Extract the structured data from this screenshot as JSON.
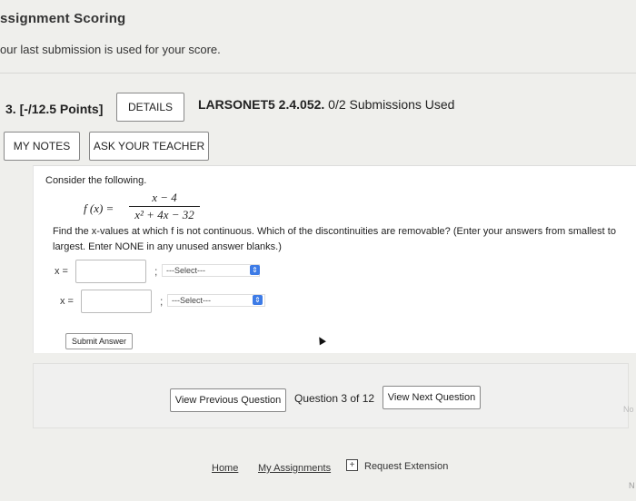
{
  "header": {
    "title": "ssignment Scoring",
    "subtitle": "our last submission is used for your score."
  },
  "question": {
    "number": "3. [-/12.5 Points]",
    "details_label": "DETAILS",
    "source": "LARSONET5 2.4.052.",
    "submissions": "0/2 Submissions Used",
    "my_notes_label": "MY NOTES",
    "ask_teacher_label": "ASK YOUR TEACHER"
  },
  "content": {
    "intro": "Consider the following.",
    "fx": "f (x) =",
    "numerator": "x − 4",
    "denominator": "x² + 4x − 32",
    "instructions": "Find the x-values at which f is not continuous. Which of the discontinuities are removable? (Enter your answers from smallest to largest. Enter NONE in any unused answer blanks.)",
    "answers": [
      {
        "label": "x =",
        "value": "",
        "separator": ";",
        "select": "---Select---"
      },
      {
        "label": "x =",
        "value": "",
        "separator": ";",
        "select": "---Select---"
      }
    ],
    "submit_label": "Submit Answer"
  },
  "navigation": {
    "prev_label": "View Previous Question",
    "position": "Question 3 of 12",
    "next_label": "View Next Question",
    "edge_text": "No"
  },
  "footer": {
    "home": "Home",
    "assignments": "My Assignments",
    "extension_icon": "+",
    "extension": "Request Extension",
    "edge_text": "N"
  },
  "colors": {
    "accent": "#3d7be6",
    "page_bg": "#efefec",
    "panel_bg": "#ffffff"
  },
  "icons": [
    "select-spinner-icon",
    "request-extension-icon",
    "mouse-cursor-icon"
  ]
}
